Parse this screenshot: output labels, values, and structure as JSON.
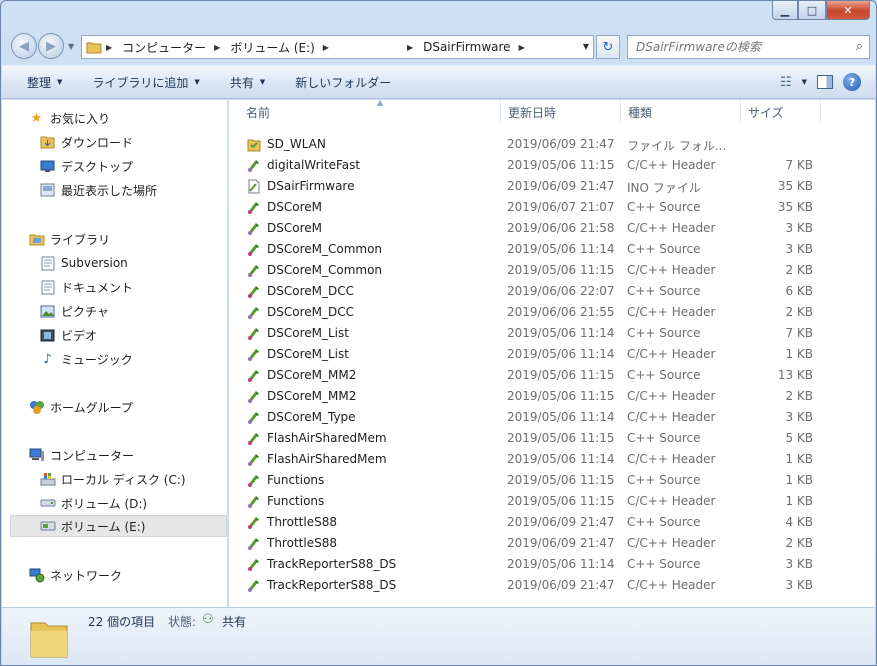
{
  "window": {
    "controls": {
      "minimize": "▁",
      "maximize": "□",
      "close": "✕"
    }
  },
  "nav": {
    "back": "◀",
    "forward": "▶"
  },
  "address": {
    "crumbs": [
      "コンピューター",
      "ボリューム (E:)",
      "DSairFirmware"
    ]
  },
  "search": {
    "placeholder": "DSairFirmwareの検索"
  },
  "toolbar": {
    "organize": "整理",
    "add_to_library": "ライブラリに追加",
    "share": "共有",
    "new_folder": "新しいフォルダー"
  },
  "sidebar": {
    "favorites": {
      "label": "お気に入り",
      "items": [
        "ダウンロード",
        "デスクトップ",
        "最近表示した場所"
      ]
    },
    "libraries": {
      "label": "ライブラリ",
      "items": [
        "Subversion",
        "ドキュメント",
        "ピクチャ",
        "ビデオ",
        "ミュージック"
      ]
    },
    "homegroup": {
      "label": "ホームグループ"
    },
    "computer": {
      "label": "コンピューター",
      "items": [
        "ローカル ディスク (C:)",
        "ボリューム (D:)",
        "ボリューム (E:)"
      ]
    },
    "network": {
      "label": "ネットワーク"
    }
  },
  "columns": {
    "name": "名前",
    "date": "更新日時",
    "type": "種類",
    "size": "サイズ"
  },
  "files": [
    {
      "name": "SD_WLAN",
      "date": "2019/06/09 21:47",
      "type": "ファイル フォル...",
      "size": "",
      "icon": "folder"
    },
    {
      "name": "digitalWriteFast",
      "date": "2019/05/06 11:15",
      "type": "C/C++ Header",
      "size": "7 KB",
      "icon": "header"
    },
    {
      "name": "DSairFirmware",
      "date": "2019/06/09 21:47",
      "type": "INO ファイル",
      "size": "35 KB",
      "icon": "ino"
    },
    {
      "name": "DSCoreM",
      "date": "2019/06/07 21:07",
      "type": "C++ Source",
      "size": "35 KB",
      "icon": "source"
    },
    {
      "name": "DSCoreM",
      "date": "2019/06/06 21:58",
      "type": "C/C++ Header",
      "size": "3 KB",
      "icon": "header"
    },
    {
      "name": "DSCoreM_Common",
      "date": "2019/05/06 11:14",
      "type": "C++ Source",
      "size": "3 KB",
      "icon": "source"
    },
    {
      "name": "DSCoreM_Common",
      "date": "2019/05/06 11:15",
      "type": "C/C++ Header",
      "size": "2 KB",
      "icon": "header"
    },
    {
      "name": "DSCoreM_DCC",
      "date": "2019/06/06 22:07",
      "type": "C++ Source",
      "size": "6 KB",
      "icon": "source"
    },
    {
      "name": "DSCoreM_DCC",
      "date": "2019/06/06 21:55",
      "type": "C/C++ Header",
      "size": "2 KB",
      "icon": "header"
    },
    {
      "name": "DSCoreM_List",
      "date": "2019/05/06 11:14",
      "type": "C++ Source",
      "size": "7 KB",
      "icon": "source"
    },
    {
      "name": "DSCoreM_List",
      "date": "2019/05/06 11:14",
      "type": "C/C++ Header",
      "size": "1 KB",
      "icon": "header"
    },
    {
      "name": "DSCoreM_MM2",
      "date": "2019/05/06 11:15",
      "type": "C++ Source",
      "size": "13 KB",
      "icon": "source"
    },
    {
      "name": "DSCoreM_MM2",
      "date": "2019/05/06 11:15",
      "type": "C/C++ Header",
      "size": "2 KB",
      "icon": "header"
    },
    {
      "name": "DSCoreM_Type",
      "date": "2019/05/06 11:14",
      "type": "C/C++ Header",
      "size": "3 KB",
      "icon": "header"
    },
    {
      "name": "FlashAirSharedMem",
      "date": "2019/05/06 11:15",
      "type": "C++ Source",
      "size": "5 KB",
      "icon": "source"
    },
    {
      "name": "FlashAirSharedMem",
      "date": "2019/05/06 11:14",
      "type": "C/C++ Header",
      "size": "1 KB",
      "icon": "header"
    },
    {
      "name": "Functions",
      "date": "2019/05/06 11:15",
      "type": "C++ Source",
      "size": "1 KB",
      "icon": "source"
    },
    {
      "name": "Functions",
      "date": "2019/05/06 11:15",
      "type": "C/C++ Header",
      "size": "1 KB",
      "icon": "header"
    },
    {
      "name": "ThrottleS88",
      "date": "2019/06/09 21:47",
      "type": "C++ Source",
      "size": "4 KB",
      "icon": "source"
    },
    {
      "name": "ThrottleS88",
      "date": "2019/06/09 21:47",
      "type": "C/C++ Header",
      "size": "2 KB",
      "icon": "header"
    },
    {
      "name": "TrackReporterS88_DS",
      "date": "2019/05/06 11:14",
      "type": "C++ Source",
      "size": "3 KB",
      "icon": "source"
    },
    {
      "name": "TrackReporterS88_DS",
      "date": "2019/06/09 21:47",
      "type": "C/C++ Header",
      "size": "3 KB",
      "icon": "header"
    }
  ],
  "details": {
    "count": "22 個の項目",
    "status_label": "状態:",
    "status_value": "共有"
  }
}
